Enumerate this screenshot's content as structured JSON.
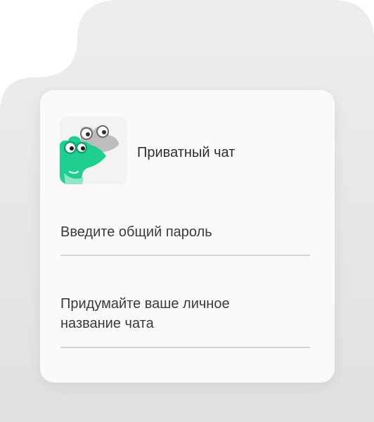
{
  "app": {
    "title": "Приватный чат",
    "logo": "frog-chat-logo"
  },
  "form": {
    "password_label": "Введите общий пароль",
    "nickname_label_line1": "Придумайте ваше личное",
    "nickname_label_line2": "название чата"
  },
  "colors": {
    "accent": "#1fcf8f",
    "card": "#fafafa",
    "background": "#e6e7e8"
  }
}
